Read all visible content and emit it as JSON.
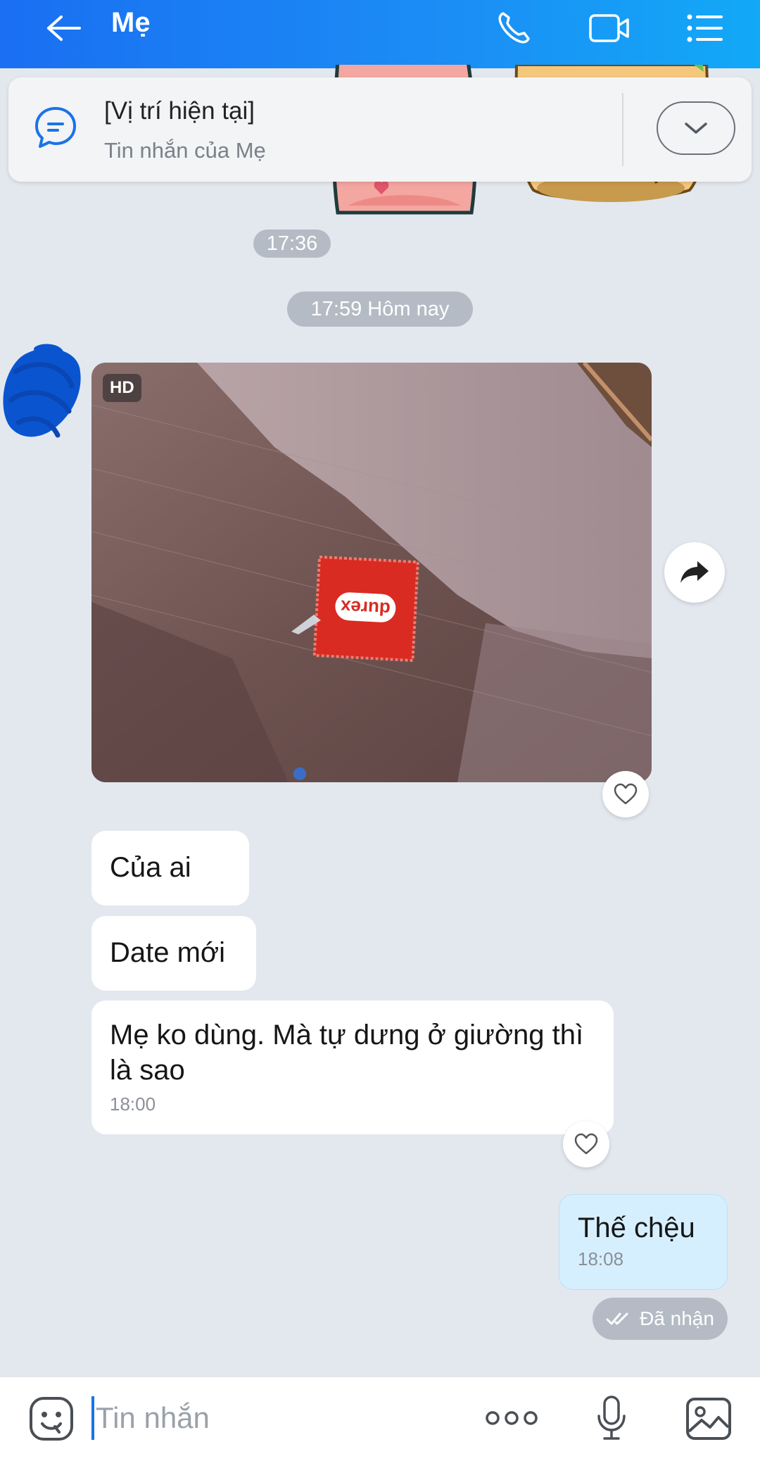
{
  "header": {
    "title": "Mẹ",
    "icons": {
      "back": "back-arrow-icon",
      "call": "phone-icon",
      "video": "video-call-icon",
      "menu": "list-menu-icon"
    }
  },
  "pinned": {
    "title": "[Vị trí hiện tại]",
    "subtitle": "Tin nhắn của Mẹ",
    "icon": "chat-bubble-icon"
  },
  "timestamps": {
    "first": "17:36",
    "second": "17:59 Hôm nay"
  },
  "photo_message": {
    "badge": "HD",
    "pack_text": "durex"
  },
  "messages": [
    {
      "text": "Của ai"
    },
    {
      "text": "Date mới"
    },
    {
      "text": "Mẹ ko dùng. Mà tự dưng ở giường thì là sao",
      "time": "18:00"
    }
  ],
  "my_message": {
    "text": "Thế chệu",
    "time": "18:08",
    "status": "Đã nhận"
  },
  "input": {
    "placeholder": "Tin nhắn"
  },
  "colors": {
    "header_start": "#1a6ff2",
    "header_end": "#12a9f7",
    "my_bubble": "#d6efff",
    "chat_bg": "#e3e8ef"
  }
}
